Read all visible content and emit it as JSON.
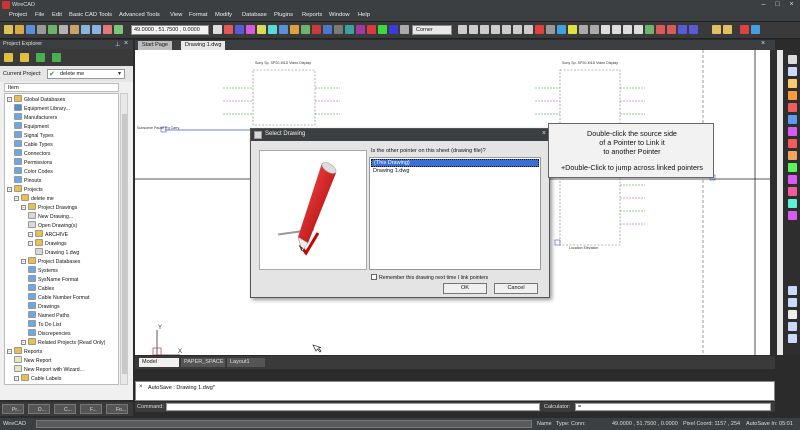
{
  "window": {
    "title": "WireCAD"
  },
  "menu": [
    "Project",
    "File",
    "Edit",
    "Basic CAD Tools",
    "Advanced Tools",
    "View",
    "Format",
    "Modify",
    "Database",
    "Plugins",
    "Reports",
    "Window",
    "Help"
  ],
  "toolbar": {
    "coords": "49.0000 , 51.7500 , 0.0000",
    "snap_mode": "Corner"
  },
  "explorer": {
    "title": "Project Explorer",
    "current_project_label": "Current Project:",
    "current_project": "delete me",
    "column_header": "Item",
    "tree": [
      {
        "label": "Global Databases",
        "level": 0,
        "icon": "folder-icon"
      },
      {
        "label": "Equipment Library...",
        "level": 1,
        "icon": "library-icon"
      },
      {
        "label": "Manufacturers",
        "level": 1,
        "icon": "table-icon"
      },
      {
        "label": "Equipment",
        "level": 1,
        "icon": "table-icon"
      },
      {
        "label": "Signal Types",
        "level": 1,
        "icon": "table-icon"
      },
      {
        "label": "Cable Types",
        "level": 1,
        "icon": "table-icon"
      },
      {
        "label": "Connectors",
        "level": 1,
        "icon": "table-icon"
      },
      {
        "label": "Permissions",
        "level": 1,
        "icon": "table-icon"
      },
      {
        "label": "Color Codes",
        "level": 1,
        "icon": "table-icon"
      },
      {
        "label": "Pinouts",
        "level": 1,
        "icon": "table-icon"
      },
      {
        "label": "Projects",
        "level": 0,
        "icon": "folder-icon"
      },
      {
        "label": "delete me",
        "level": 1,
        "icon": "folder-icon"
      },
      {
        "label": "Project Drawings",
        "level": 2,
        "icon": "folder-icon"
      },
      {
        "label": "New Drawing...",
        "level": 3,
        "icon": "drawing-icon"
      },
      {
        "label": "Open Drawing(s)",
        "level": 3,
        "icon": "drawing-icon"
      },
      {
        "label": "ARCHIVE",
        "level": 3,
        "icon": "folder-icon"
      },
      {
        "label": "Drawings",
        "level": 3,
        "icon": "folder-icon"
      },
      {
        "label": "Drawing 1.dwg",
        "level": 4,
        "icon": "drawing-icon"
      },
      {
        "label": "Project Databases",
        "level": 2,
        "icon": "folder-icon"
      },
      {
        "label": "Systems",
        "level": 3,
        "icon": "table-icon"
      },
      {
        "label": "SysName Format",
        "level": 3,
        "icon": "table-icon"
      },
      {
        "label": "Cables",
        "level": 3,
        "icon": "table-icon"
      },
      {
        "label": "Cable Number Format",
        "level": 3,
        "icon": "table-icon"
      },
      {
        "label": "Drawings",
        "level": 3,
        "icon": "table-icon"
      },
      {
        "label": "Named Paths",
        "level": 3,
        "icon": "table-icon"
      },
      {
        "label": "To Do List",
        "level": 3,
        "icon": "table-icon"
      },
      {
        "label": "Discrepencies",
        "level": 3,
        "icon": "table-icon"
      },
      {
        "label": "Related Projects (Read Only)",
        "level": 2,
        "icon": "folder-icon"
      },
      {
        "label": "Reports",
        "level": 0,
        "icon": "folder-icon"
      },
      {
        "label": "New Report",
        "level": 1,
        "icon": "report-icon"
      },
      {
        "label": "New Report with Wizard...",
        "level": 1,
        "icon": "report-icon"
      },
      {
        "label": "Cable Labels",
        "level": 1,
        "icon": "folder-icon"
      }
    ],
    "bottom_tabs": [
      "Pr...",
      "D...",
      "C...",
      "F...",
      "Fo..."
    ]
  },
  "doc_tabs": [
    "Start Page",
    "Drawing 1.dwg"
  ],
  "layout_tabs": [
    "Model",
    "PAPER_SPACE",
    "Layout1"
  ],
  "dialog": {
    "title": "Select Drawing",
    "prompt": "Is the other pointer on this sheet (drawing file)?",
    "options": [
      "(This Drawing)",
      "Drawing 1.dwg"
    ],
    "selected_index": 0,
    "remember_label": "Remember this drawing next time I link pointers",
    "ok_label": "OK",
    "cancel_label": "Cancel"
  },
  "callout": {
    "line1": "Double-click the source side",
    "line2": "of a Pointer to Link it",
    "line3": "to another Pointer",
    "line4": "+Double-Click to jump across linked pointers"
  },
  "command": {
    "history": "AutoSave : Drawing 1.dwg*",
    "label": "Command:",
    "calculator_label": "Calculator:",
    "calculator_value": "="
  },
  "status": {
    "left": "WireCAD",
    "name": "Name",
    "type": "Type: Conn:",
    "coords": "49.0000 , 51.7500 , 0.0000",
    "pixel": "Pixel Coord: 1157 , 254",
    "autosave": "AutoSave In: 05:01"
  },
  "canvas": {
    "axis_y": "Y",
    "axis_x": "X",
    "left_block_title": "Sony Sp. SP20-M1D Video Display",
    "right_block_title": "Sony Sp. SP20-M1D Video Display",
    "pointer_label": "Subscene Pause Pg Carry",
    "location_label": "Location Elevation"
  }
}
